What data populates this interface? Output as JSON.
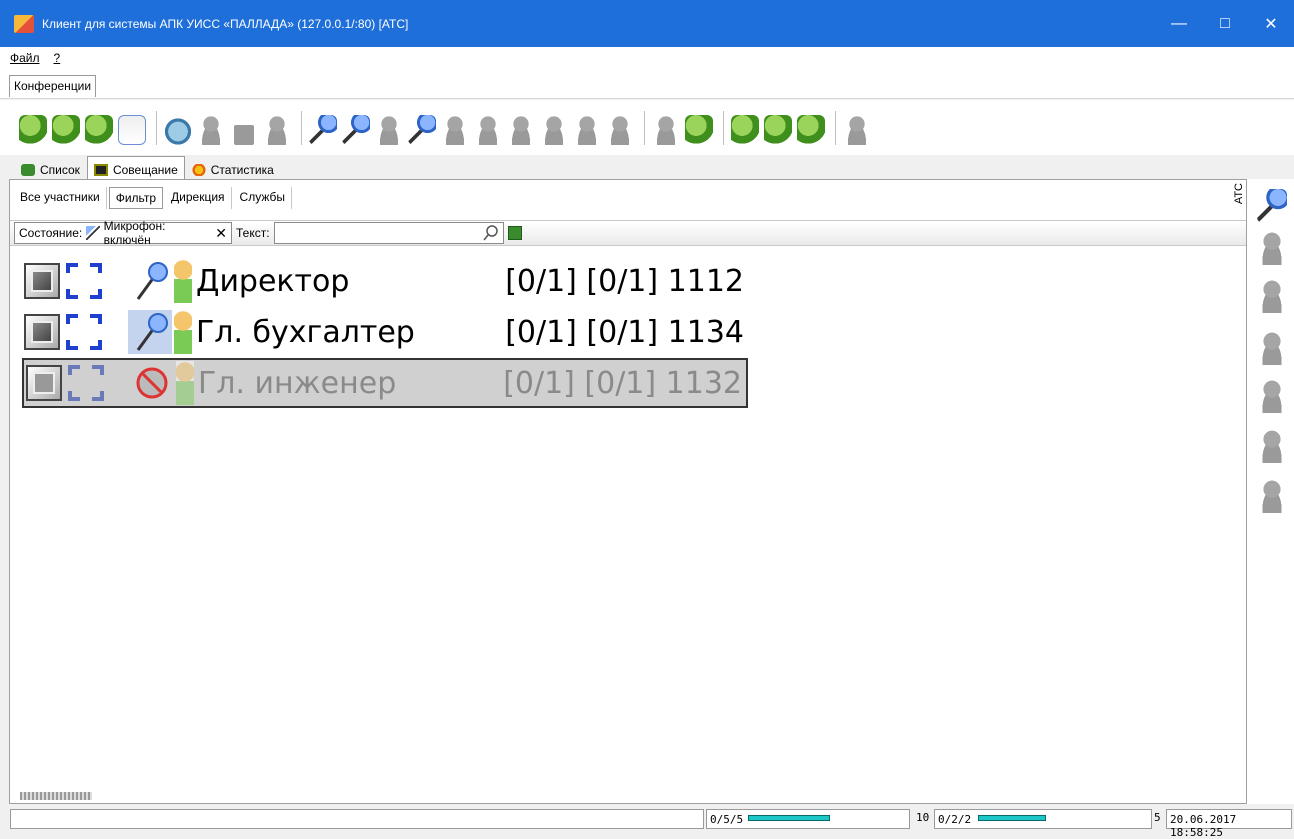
{
  "window": {
    "title": "Клиент для системы АПК УИСС «ПАЛЛАДА» (127.0.0.1/:80) [АТС]",
    "minimize": "—",
    "maximize": "□",
    "close": "✕"
  },
  "menu": {
    "file": "Файл",
    "help": "?"
  },
  "conference_tab": "Конференции",
  "toolbar_icons": [
    "add-conference-icon",
    "edit-conference-icon",
    "conference-settings-icon",
    "calendar-icon",
    "phone-icon",
    "play-icon",
    "stop-icon",
    "record-icon",
    "microphone-icon",
    "audio-settings-icon",
    "mute-all-icon",
    "mute-mic-icon",
    "alarm-icon",
    "bell-icon",
    "user-icon",
    "user-icon",
    "user-icon",
    "user-icon",
    "user-call-icon",
    "user-active-icon",
    "add-user-icon",
    "user-settings-icon",
    "remove-user-icon",
    "group-icon"
  ],
  "tabs": [
    {
      "label": "Список",
      "icon": "list-icon"
    },
    {
      "label": "Совещание",
      "icon": "meeting-icon"
    },
    {
      "label": "Статистика",
      "icon": "statistics-icon"
    }
  ],
  "filter_tabs": [
    "Все участники",
    "Фильтр",
    "Дирекция",
    "Службы"
  ],
  "state": {
    "label": "Состояние:",
    "value": "Микрофон: включён",
    "clear": "✕",
    "text_label": "Текст:",
    "text_value": ""
  },
  "participants": [
    {
      "name": "Директор",
      "info": "[0/1] [0/1] 1112",
      "mic_state": "on",
      "selected": false,
      "disabled": false
    },
    {
      "name": "Гл. бухгалтер",
      "info": "[0/1] [0/1] 1134",
      "mic_state": "on-highlighted",
      "selected": false,
      "disabled": false
    },
    {
      "name": "Гл. инженер",
      "info": "[0/1] [0/1] 1132",
      "mic_state": "disabled",
      "selected": true,
      "disabled": true
    }
  ],
  "sidebar": {
    "label": "АТС",
    "icons": [
      "microphone-icon",
      "mute-icon",
      "alarm-icon",
      "bell-icon",
      "headset-icon",
      "move-icon",
      "user-icon"
    ]
  },
  "status": {
    "counter1": "0/5/5",
    "progress1": 0.85,
    "counter2": "10",
    "counter3": "0/2/2",
    "progress2": 0.45,
    "counter4": "5",
    "datetime": "20.06.2017 18:58:25"
  },
  "colors": {
    "titlebar": "#1e6fd9",
    "progress": "#1ec7c7",
    "selection": "#d0d0d0"
  }
}
